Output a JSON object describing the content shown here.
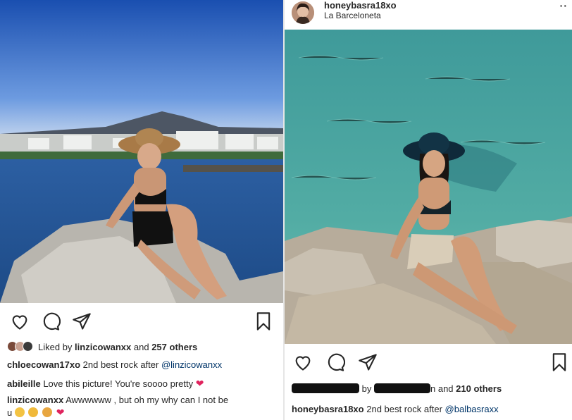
{
  "left_post": {
    "likes": {
      "prefix": "Liked by",
      "user": "linzicowanxx",
      "mid": "and",
      "count": "257 others"
    },
    "caption": {
      "user": "chloecowan17xo",
      "text": "2nd best rock after",
      "mention": "@linzicowanxx"
    },
    "comments": [
      {
        "user": "abileille",
        "text": "Love this picture! You're soooo pretty"
      },
      {
        "user": "linzicowanxx",
        "text": "Awwwwww , but oh my why can I not be",
        "continuation": "u"
      }
    ]
  },
  "right_post": {
    "header": {
      "username": "honeybasra18xo",
      "location": "La Barceloneta",
      "more": "··"
    },
    "likes": {
      "visible_fragment": "by",
      "visible_fragment_2": "n",
      "mid": "and",
      "count": "210 others"
    },
    "caption": {
      "user": "honeybasra18xo",
      "text": "2nd best rock after",
      "mention": "@balbasraxx"
    }
  },
  "icons": [
    "heart-icon",
    "comment-icon",
    "share-icon",
    "bookmark-icon",
    "red-heart-emoji",
    "worried-emoji",
    "sad-emoji",
    "cat-emoji"
  ],
  "colors": {
    "mention": "#003569",
    "heart": "#e0245e",
    "text": "#262626"
  }
}
